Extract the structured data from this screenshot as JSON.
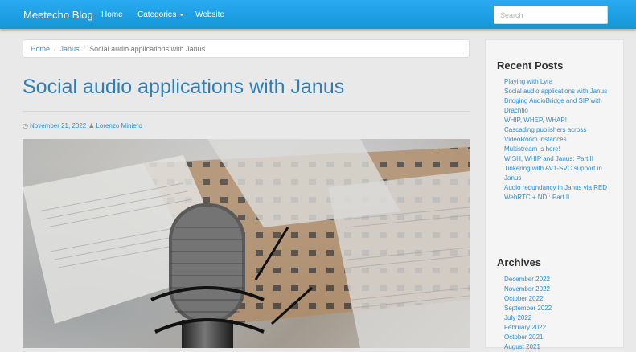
{
  "navbar": {
    "brand": "Meetecho Blog",
    "links": [
      "Home",
      "Categories",
      "Website"
    ],
    "search_placeholder": "Search"
  },
  "breadcrumb": {
    "items": [
      "Home",
      "Janus"
    ],
    "current": "Social audio applications with Janus"
  },
  "post": {
    "title": "Social audio applications with Janus",
    "date": "November 21, 2022",
    "author": "Lorenzo Miniero"
  },
  "sidebar": {
    "recent_title": "Recent Posts",
    "recent_posts": [
      "Playing with Lyra",
      "Social audio applications with Janus",
      "Bridging AudioBridge and SIP with Drachtio",
      "WHIP, WHEP, WHAP!",
      "Cascading publishers across VideoRoom instances",
      "Multistream is here!",
      "WISH, WHIP and Janus: Part II",
      "Tinkering with AV1-SVC support in Janus",
      "Audio redundancy in Janus via RED",
      "WebRTC + NDI: Part II"
    ],
    "archives_title": "Archives",
    "archives": [
      "December 2022",
      "November 2022",
      "October 2022",
      "September 2022",
      "July 2022",
      "February 2022",
      "October 2021",
      "August 2021"
    ]
  },
  "colors": {
    "navbar": "#1fa1e3",
    "link": "#2b8fd6",
    "title": "#2f7fb6"
  }
}
